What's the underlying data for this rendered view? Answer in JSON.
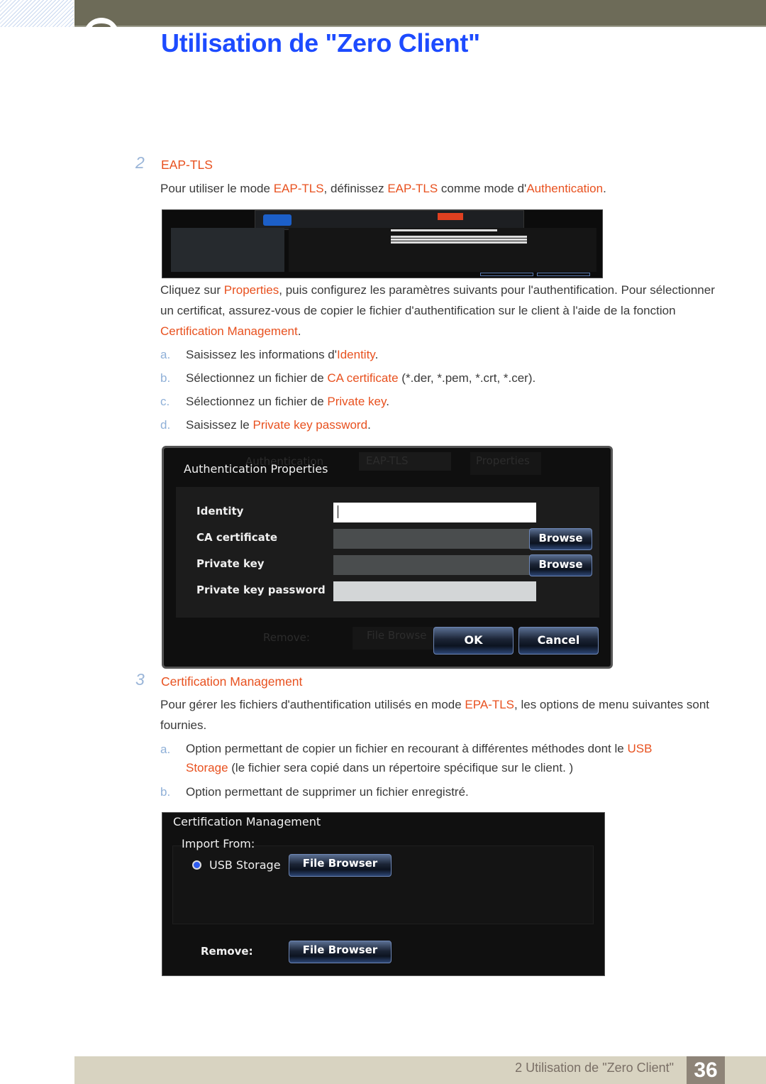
{
  "header": {
    "title": "Utilisation de \"Zero Client\""
  },
  "section2": {
    "number": "2",
    "heading": "EAP-TLS",
    "intro": [
      "Pour utiliser le mode ",
      "EAP-TLS",
      ", définissez ",
      "EAP-TLS",
      " comme mode d'",
      "Authentication",
      "."
    ],
    "para": [
      "Cliquez sur ",
      "Properties",
      ", puis configurez les paramètres suivants pour l'authentification. Pour sélectionner un certificat, assurez-vous de copier le fichier d'authentification sur le client à l'aide de la fonction ",
      "Certification Management",
      "."
    ],
    "list": [
      {
        "letter": "a.",
        "parts": [
          "Saisissez les informations d'",
          "Identity",
          "."
        ]
      },
      {
        "letter": "b.",
        "parts": [
          "Sélectionnez un fichier de ",
          "CA certificate",
          " (*.der, *.pem, *.crt, *.cer)."
        ]
      },
      {
        "letter": "c.",
        "parts": [
          "Sélectionnez un fichier de ",
          "Private key",
          "."
        ]
      },
      {
        "letter": "d.",
        "parts": [
          "Saisissez le ",
          "Private key password",
          "."
        ]
      }
    ]
  },
  "dialog": {
    "title": "Authentication Properties",
    "background": {
      "authentication": "Authentication",
      "mode": "EAP-TLS",
      "properties": "Properties",
      "remove": "Remove:",
      "file_browser": "File Browse"
    },
    "fields": [
      {
        "label": "Identity",
        "value": ""
      },
      {
        "label": "CA certificate",
        "button": "Browse"
      },
      {
        "label": "Private key",
        "button": "Browse"
      },
      {
        "label": "Private key password",
        "value": ""
      }
    ],
    "ok": "OK",
    "cancel": "Cancel"
  },
  "section3": {
    "number": "3",
    "heading": "Certification Management",
    "para": [
      "Pour gérer les fichiers d'authentification utilisés en mode ",
      "EPA-TLS",
      ", les options de menu suivantes sont fournies."
    ],
    "list": [
      {
        "letter": "a.",
        "parts": [
          "Option permettant de copier un fichier en recourant à différentes méthodes dont le ",
          "USB Storage",
          " (le fichier sera copié dans un répertoire spécifique sur le client. )"
        ]
      },
      {
        "letter": "b.",
        "parts": [
          "Option permettant de supprimer un fichier enregistré."
        ]
      }
    ]
  },
  "cert_mgmt": {
    "title": "Certification Management",
    "import_from": "Import From:",
    "usb_storage": "USB Storage",
    "file_browser": "File Browser",
    "remove": "Remove:",
    "remove_button": "File Browser"
  },
  "footer": {
    "text": "2 Utilisation de \"Zero Client\"",
    "page": "36"
  },
  "colors": {
    "title": "#1d4bff",
    "highlight": "#e8511f",
    "list_letter": "#8fb0d8",
    "top_bar": "#6d6b58",
    "footer": "#d8d3c1"
  }
}
